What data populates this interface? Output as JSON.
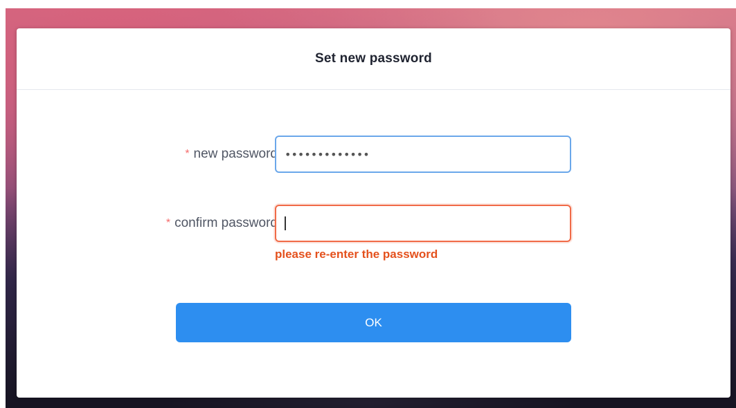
{
  "dialog": {
    "title": "Set new password"
  },
  "form": {
    "new_password": {
      "required_mark": "*",
      "label": "new password",
      "value": "•••••••••••••"
    },
    "confirm_password": {
      "required_mark": "*",
      "label": "confirm password",
      "value": "",
      "error": "please re-enter the password"
    },
    "submit_label": "OK"
  },
  "colors": {
    "primary": "#2d8ef0",
    "error": "#e4511d",
    "focus_border": "#6aa7ea",
    "required": "#f56c6c"
  }
}
